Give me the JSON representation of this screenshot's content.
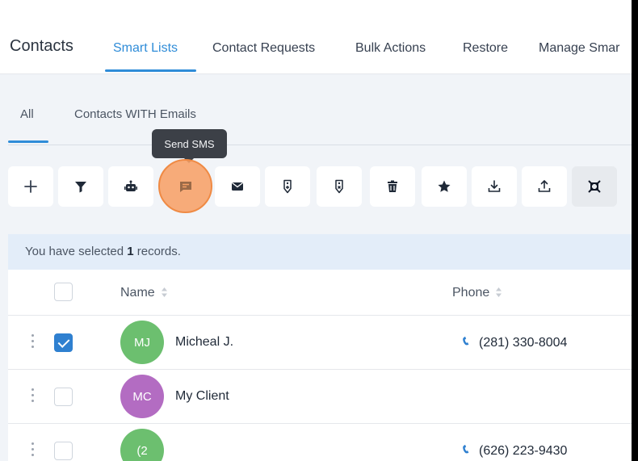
{
  "header": {
    "title": "Contacts",
    "tabs": [
      {
        "label": "Smart Lists",
        "active": true
      },
      {
        "label": "Contact Requests",
        "active": false
      },
      {
        "label": "Bulk Actions",
        "active": false
      },
      {
        "label": "Restore",
        "active": false
      },
      {
        "label": "Manage Smar",
        "active": false
      }
    ]
  },
  "subtabs": [
    {
      "label": "All",
      "active": true
    },
    {
      "label": "Contacts WITH Emails",
      "active": false
    }
  ],
  "tooltip": {
    "text": "Send SMS"
  },
  "toolbar": {
    "buttons": [
      {
        "icon": "plus-icon",
        "name": "add-contact-button"
      },
      {
        "icon": "filter-icon",
        "name": "filter-button"
      },
      {
        "icon": "robot-icon",
        "name": "automation-button"
      },
      {
        "icon": "message-icon",
        "name": "send-sms-button",
        "highlighted": true
      },
      {
        "icon": "envelope-icon",
        "name": "send-email-button"
      },
      {
        "icon": "tag-add-icon",
        "name": "add-tag-button"
      },
      {
        "icon": "tag-remove-icon",
        "name": "remove-tag-button"
      },
      {
        "icon": "trash-icon",
        "name": "delete-button"
      },
      {
        "icon": "star-icon",
        "name": "star-button"
      },
      {
        "icon": "download-icon",
        "name": "export-button"
      },
      {
        "icon": "upload-icon",
        "name": "import-button"
      },
      {
        "icon": "merge-icon",
        "name": "merge-button"
      }
    ]
  },
  "selection": {
    "prefix": "You have selected ",
    "count": "1",
    "suffix": " records."
  },
  "table": {
    "columns": {
      "name": "Name",
      "phone": "Phone"
    },
    "rows": [
      {
        "initials": "MJ",
        "name": "Micheal J.",
        "phone": "(281) 330-8004",
        "checked": true,
        "avatar_color": "#6cbf6f"
      },
      {
        "initials": "MC",
        "name": "My Client",
        "phone": "",
        "checked": false,
        "avatar_color": "#b36cc2"
      },
      {
        "initials": "(2",
        "name": "",
        "phone": "(626) 223-9430",
        "checked": false,
        "avatar_color": "#6cbf6f"
      }
    ]
  },
  "colors": {
    "accent": "#2f8cd8",
    "highlight": "#f7a166",
    "phone_icon": "#2f80d0"
  }
}
